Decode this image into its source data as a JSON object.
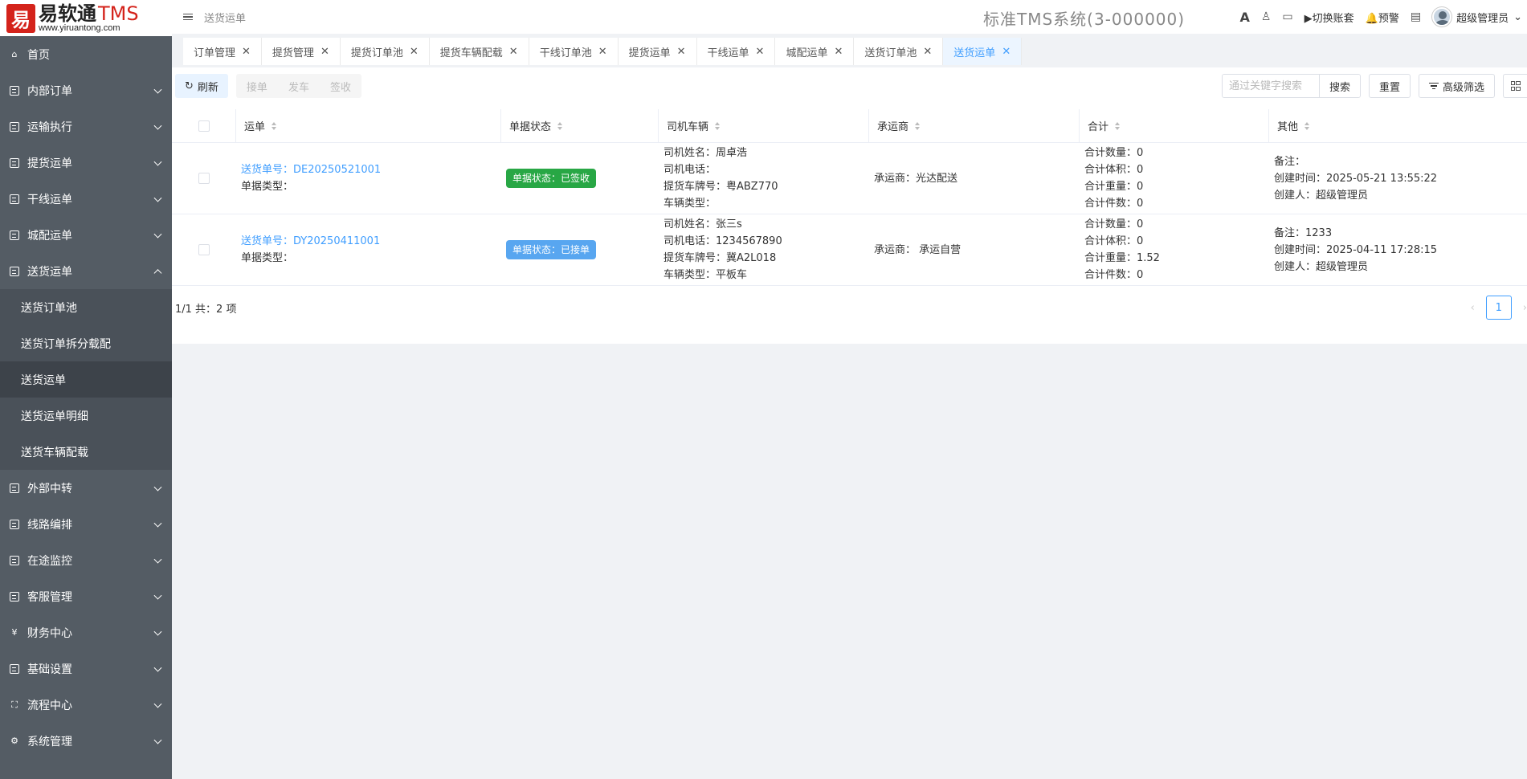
{
  "logo": {
    "badge": "易",
    "name": "易软通",
    "tms": "TMS",
    "url": "www.yiruantong.com"
  },
  "header": {
    "breadcrumb": "送货运单",
    "system_title": "标准TMS系统(3-000000)",
    "font_icon_label": "A",
    "switch_label": "切换账套",
    "alert_label": "预警",
    "user_name": "超级管理员"
  },
  "sidebar": {
    "items": [
      {
        "label": "首页",
        "icon": "home-icon"
      },
      {
        "label": "内部订单",
        "icon": "box-icon"
      },
      {
        "label": "运输执行",
        "icon": "box-icon"
      },
      {
        "label": "提货运单",
        "icon": "box-icon"
      },
      {
        "label": "干线运单",
        "icon": "box-icon"
      },
      {
        "label": "城配运单",
        "icon": "box-icon"
      },
      {
        "label": "送货运单",
        "icon": "box-icon"
      },
      {
        "label": "外部中转",
        "icon": "box-icon"
      },
      {
        "label": "线路编排",
        "icon": "box-icon"
      },
      {
        "label": "在途监控",
        "icon": "box-icon"
      },
      {
        "label": "客服管理",
        "icon": "box-icon"
      },
      {
        "label": "财务中心",
        "icon": "yen-icon"
      },
      {
        "label": "基础设置",
        "icon": "box-icon"
      },
      {
        "label": "流程中心",
        "icon": "org-icon"
      },
      {
        "label": "系统管理",
        "icon": "gear-icon"
      }
    ],
    "sub_items": [
      "送货订单池",
      "送货订单拆分载配",
      "送货运单",
      "送货运单明细",
      "送货车辆配载"
    ]
  },
  "tabs": [
    "订单管理",
    "提货管理",
    "提货订单池",
    "提货车辆配载",
    "干线订单池",
    "提货运单",
    "干线运单",
    "城配运单",
    "送货订单池",
    "送货运单"
  ],
  "toolbar": {
    "refresh": "刷新",
    "accept": "接单",
    "depart": "发车",
    "sign": "签收",
    "search_placeholder": "通过关键字搜索",
    "search": "搜索",
    "reset": "重置",
    "advanced": "高级筛选"
  },
  "table": {
    "headers": [
      "运单",
      "单据状态",
      "司机车辆",
      "承运商",
      "合计",
      "其他"
    ],
    "rows": [
      {
        "waybill": "送货单号：DE20250521001",
        "doc_type": "单据类型：",
        "status": "单据状态：已签收",
        "driver_name": "司机姓名：周卓浩",
        "driver_phone": "司机电话：",
        "plate": "提货车牌号：粤ABZ770",
        "vehicle_type": "车辆类型：",
        "carrier": "承运商：光达配送",
        "qty": "合计数量：0",
        "volume": "合计体积：0",
        "weight": "合计重量：0",
        "pieces": "合计件数：0",
        "remark": "备注：",
        "created": "创建时间：2025-05-21 13:55:22",
        "creator": "创建人：超级管理员"
      },
      {
        "waybill": "送货单号：DY20250411001",
        "doc_type": "单据类型：",
        "status": "单据状态：已接单",
        "driver_name": "司机姓名：张三s",
        "driver_phone": "司机电话：1234567890",
        "plate": "提货车牌号：冀A2L018",
        "vehicle_type": "车辆类型：平板车",
        "carrier": "承运商： 承运自营",
        "qty": "合计数量：0",
        "volume": "合计体积：0",
        "weight": "合计重量：1.52",
        "pieces": "合计件数：0",
        "remark": "备注：1233",
        "created": "创建时间：2025-04-11 17:28:15",
        "creator": "创建人：超级管理员"
      }
    ]
  },
  "pagination": {
    "summary": "1/1 共：2 项",
    "current": "1",
    "prev": "‹",
    "next": "›"
  },
  "colors": {
    "sidebar": "#545c64",
    "accent": "#409eff",
    "status_signed": "#28a745",
    "status_accepted": "#58a6f0"
  }
}
